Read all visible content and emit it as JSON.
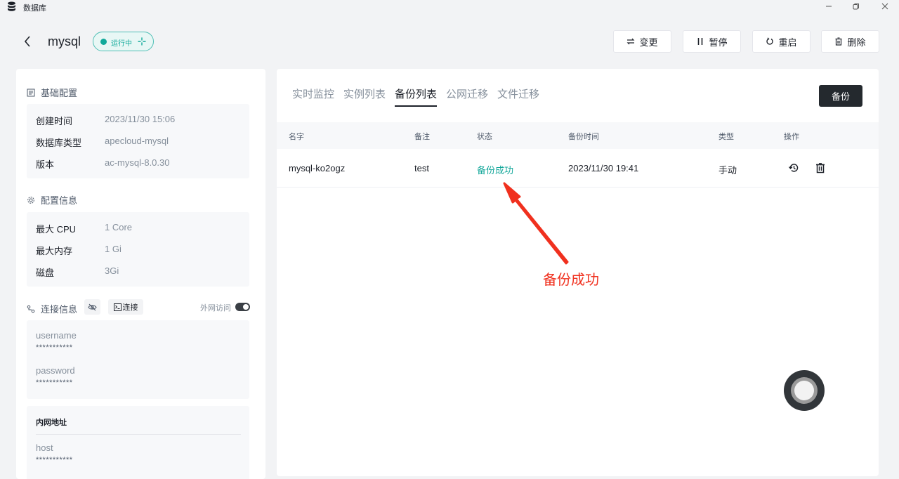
{
  "window": {
    "title": "数据库",
    "controls": [
      "minimize",
      "restore",
      "close"
    ]
  },
  "header": {
    "db_name": "mysql",
    "status": "运行中",
    "status_color": "#10a99a",
    "actions": [
      {
        "label": "变更",
        "icon": "swap-icon"
      },
      {
        "label": "暂停",
        "icon": "pause-icon"
      },
      {
        "label": "重启",
        "icon": "restart-icon"
      },
      {
        "label": "删除",
        "icon": "trash-icon"
      }
    ]
  },
  "basic_config": {
    "title": "基础配置",
    "rows": [
      {
        "key": "创建时间",
        "value": "2023/11/30 15:06"
      },
      {
        "key": "数据库类型",
        "value": "apecloud-mysql"
      },
      {
        "key": "版本",
        "value": "ac-mysql-8.0.30"
      }
    ]
  },
  "resource_config": {
    "title": "配置信息",
    "rows": [
      {
        "key": "最大 CPU",
        "value": "1 Core"
      },
      {
        "key": "最大内存",
        "value": "1 Gi"
      },
      {
        "key": "磁盘",
        "value": "3Gi"
      }
    ]
  },
  "connection": {
    "title": "连接信息",
    "connect_label": "连接",
    "external_access_label": "外网访问",
    "external_access_enabled": true,
    "credentials": [
      {
        "label": "username",
        "value": "***********"
      },
      {
        "label": "password",
        "value": "***********"
      }
    ],
    "internal": {
      "title": "内网地址",
      "host_label": "host",
      "host_value": "***********"
    }
  },
  "tabs": [
    {
      "label": "实时监控",
      "active": false
    },
    {
      "label": "实例列表",
      "active": false
    },
    {
      "label": "备份列表",
      "active": true
    },
    {
      "label": "公网迁移",
      "active": false
    },
    {
      "label": "文件迁移",
      "active": false
    }
  ],
  "backup_button": "备份",
  "table": {
    "columns": [
      "名字",
      "备注",
      "状态",
      "备份时间",
      "类型",
      "操作"
    ],
    "rows": [
      {
        "name": "mysql-ko2ogz",
        "remark": "test",
        "status": "备份成功",
        "time": "2023/11/30 19:41",
        "type": "手动",
        "actions": [
          "restore-icon",
          "delete-icon"
        ]
      }
    ]
  },
  "annotation": {
    "text": "备份成功",
    "color": "#f0301e"
  }
}
